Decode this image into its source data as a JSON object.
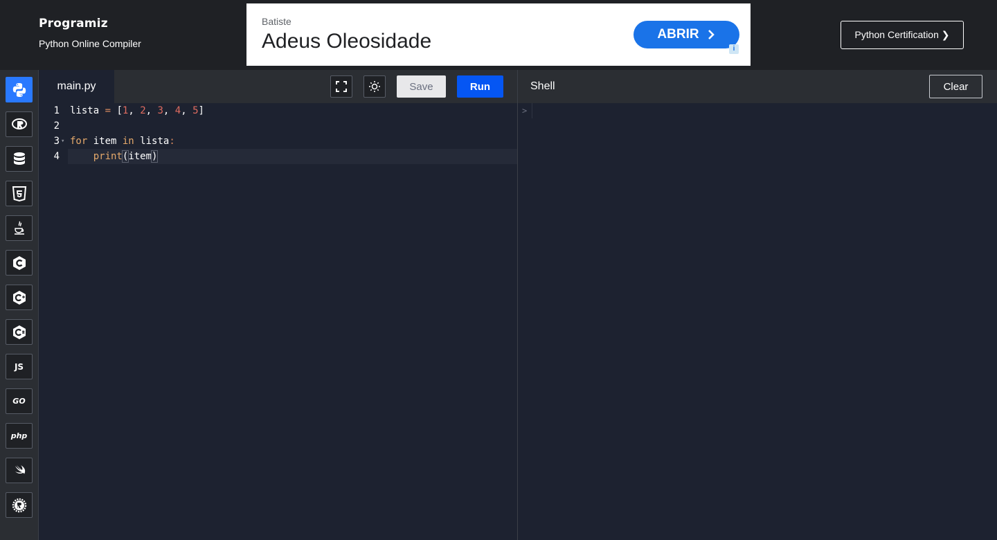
{
  "header": {
    "logo_text": "Programiz",
    "subtitle": "Python Online Compiler",
    "certification_label": "Python Certification ❯"
  },
  "ad": {
    "brand": "Batiste",
    "headline": "Adeus Oleosidade",
    "cta_label": "ABRIR",
    "info_glyph": "i"
  },
  "sidebar": {
    "languages": [
      {
        "name": "python-icon",
        "active": true
      },
      {
        "name": "r-icon"
      },
      {
        "name": "sql-icon"
      },
      {
        "name": "html-icon"
      },
      {
        "name": "java-icon"
      },
      {
        "name": "c-icon"
      },
      {
        "name": "cpp-icon"
      },
      {
        "name": "csharp-icon"
      },
      {
        "name": "javascript-icon",
        "label": "JS"
      },
      {
        "name": "go-icon",
        "label": "GO"
      },
      {
        "name": "php-icon",
        "label": "php"
      },
      {
        "name": "swift-icon"
      },
      {
        "name": "rust-icon"
      }
    ]
  },
  "editor": {
    "tab_label": "main.py",
    "save_label": "Save",
    "run_label": "Run",
    "line_numbers": [
      "1",
      "2",
      "3",
      "4"
    ],
    "code": {
      "l1_var": "lista",
      "l1_eq": " = ",
      "l1_open": "[",
      "l1_n1": "1",
      "l1_n2": "2",
      "l1_n3": "3",
      "l1_n4": "4",
      "l1_n5": "5",
      "l1_sep": ", ",
      "l1_close": "]",
      "l3_for": "for",
      "l3_item": " item ",
      "l3_in": "in",
      "l3_lista": " lista",
      "l3_colon": ":",
      "l4_indent": "    ",
      "l4_print": "print",
      "l4_open": "(",
      "l4_arg": "item",
      "l4_close": ")"
    }
  },
  "shell": {
    "title": "Shell",
    "clear_label": "Clear",
    "prompt": ">"
  },
  "colors": {
    "run": "#0556f3",
    "active_lang": "#2979ff",
    "ad_cta": "#1a73e8"
  }
}
